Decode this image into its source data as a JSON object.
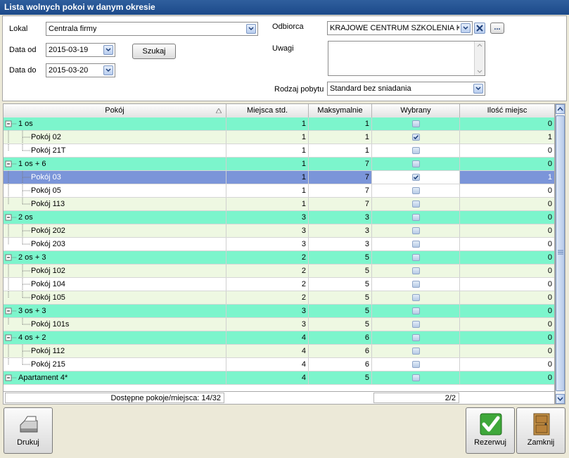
{
  "window": {
    "title": "Lista wolnych pokoi w danym okresie"
  },
  "form": {
    "lokal_label": "Lokal",
    "lokal_value": "Centrala firmy",
    "data_od_label": "Data od",
    "data_od_value": "2015-03-19",
    "data_do_label": "Data do",
    "data_do_value": "2015-03-20",
    "search_label": "Szukaj",
    "odbiorca_label": "Odbiorca",
    "odbiorca_value": "KRAJOWE CENTRUM SZKOLENIA KADF",
    "more_label": "...",
    "uwagi_label": "Uwagi",
    "uwagi_value": "",
    "rodzaj_label": "Rodzaj pobytu",
    "rodzaj_value": "Standard bez sniadania"
  },
  "grid": {
    "columns": [
      "Pokój",
      "Miejsca std.",
      "Maksymalnie",
      "Wybrany",
      "Ilość miejsc"
    ],
    "rows": [
      {
        "type": "group",
        "name": "1 os",
        "std": "1",
        "max": "1",
        "sel": false,
        "qty": "0"
      },
      {
        "type": "item",
        "name": "Pokój 02",
        "std": "1",
        "max": "1",
        "sel": true,
        "qty": "1"
      },
      {
        "type": "item",
        "name": "Pokój 21T",
        "std": "1",
        "max": "1",
        "sel": false,
        "qty": "0"
      },
      {
        "type": "group",
        "name": "1 os + 6",
        "std": "1",
        "max": "7",
        "sel": false,
        "qty": "0"
      },
      {
        "type": "item",
        "name": "Pokój 03",
        "std": "1",
        "max": "7",
        "sel": true,
        "qty": "1",
        "selected": true
      },
      {
        "type": "item",
        "name": "Pokój 05",
        "std": "1",
        "max": "7",
        "sel": false,
        "qty": "0"
      },
      {
        "type": "item",
        "name": "Pokój 113",
        "std": "1",
        "max": "7",
        "sel": false,
        "qty": "0"
      },
      {
        "type": "group",
        "name": "2 os",
        "std": "3",
        "max": "3",
        "sel": false,
        "qty": "0"
      },
      {
        "type": "item",
        "name": "Pokój 202",
        "std": "3",
        "max": "3",
        "sel": false,
        "qty": "0"
      },
      {
        "type": "item",
        "name": "Pokój 203",
        "std": "3",
        "max": "3",
        "sel": false,
        "qty": "0"
      },
      {
        "type": "group",
        "name": "2 os + 3",
        "std": "2",
        "max": "5",
        "sel": false,
        "qty": "0"
      },
      {
        "type": "item",
        "name": "Pokój 102",
        "std": "2",
        "max": "5",
        "sel": false,
        "qty": "0"
      },
      {
        "type": "item",
        "name": "Pokój 104",
        "std": "2",
        "max": "5",
        "sel": false,
        "qty": "0"
      },
      {
        "type": "item",
        "name": "Pokój 105",
        "std": "2",
        "max": "5",
        "sel": false,
        "qty": "0"
      },
      {
        "type": "group",
        "name": "3 os + 3",
        "std": "3",
        "max": "5",
        "sel": false,
        "qty": "0"
      },
      {
        "type": "item",
        "name": "Pokój 101s",
        "std": "3",
        "max": "5",
        "sel": false,
        "qty": "0"
      },
      {
        "type": "group",
        "name": "4 os + 2",
        "std": "4",
        "max": "6",
        "sel": false,
        "qty": "0"
      },
      {
        "type": "item",
        "name": "Pokój 112",
        "std": "4",
        "max": "6",
        "sel": false,
        "qty": "0"
      },
      {
        "type": "item",
        "name": "Pokój 215",
        "std": "4",
        "max": "6",
        "sel": false,
        "qty": "0"
      },
      {
        "type": "group",
        "name": "Apartament 4*",
        "std": "4",
        "max": "5",
        "sel": false,
        "qty": "0"
      }
    ],
    "footer_summary": "Dostępne pokoje/miejsca: 14/32",
    "footer_count": "2/2"
  },
  "buttons": {
    "print": "Drukuj",
    "reserve": "Rezerwuj",
    "close": "Zamknij"
  },
  "colors": {
    "group_row": "#7cf5cc",
    "alt_row": "#eef8e2",
    "selected_row": "#7b95d9",
    "title_bar": "#1c4a8a"
  }
}
